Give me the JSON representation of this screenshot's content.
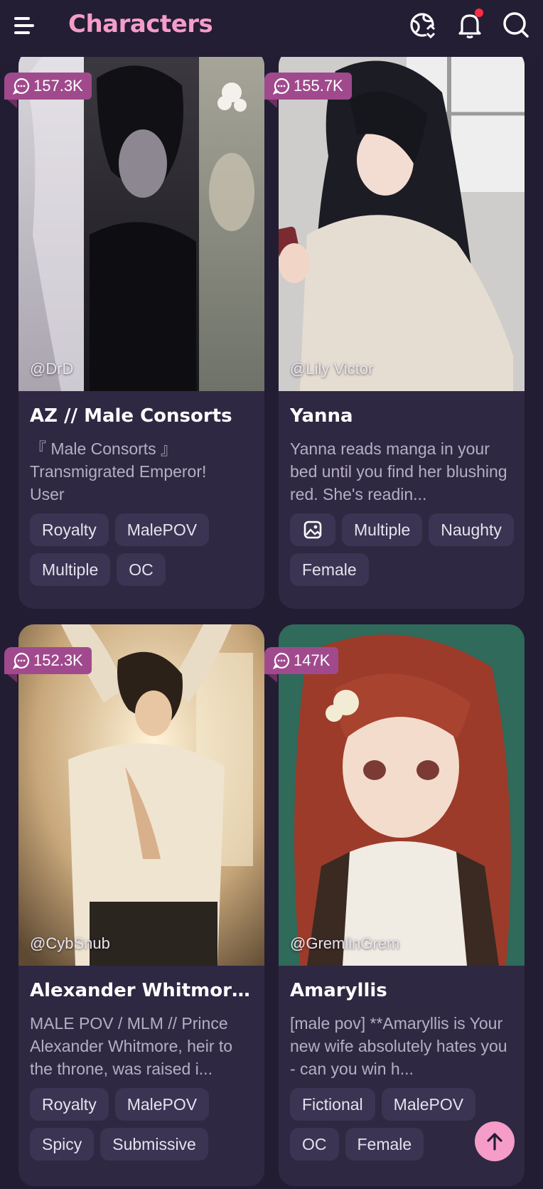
{
  "header": {
    "title": "Characters",
    "icons": [
      "menu-icon",
      "globe-language-icon",
      "bell-icon",
      "search-icon"
    ],
    "accent": "#f59cc8",
    "notification_dot_color": "#ff2d3f"
  },
  "cards": [
    {
      "chat_count": "157.3K",
      "author": "@DrD",
      "name": "AZ // Male Consorts",
      "description": "『 Male Consorts 』\nTransmigrated Emperor!\nUser",
      "tags": [
        "Royalty",
        "MalePOV",
        "Multiple",
        "OC"
      ]
    },
    {
      "chat_count": "155.7K",
      "author": "@Lily Victor",
      "name": "Yanna",
      "description": "Yanna reads manga in your bed until you find her blushing red. She's readin...",
      "has_image_tag": true,
      "tags": [
        "Multiple",
        "Naughty",
        "Female"
      ]
    },
    {
      "chat_count": "152.3K",
      "author": "@CybSnub",
      "name": "Alexander Whitmore ||...",
      "description": "MALE POV / MLM // Prince Alexander Whitmore, heir to the throne, was raised i...",
      "tags": [
        "Royalty",
        "MalePOV",
        "Spicy",
        "Submissive"
      ]
    },
    {
      "chat_count": "147K",
      "author": "@GremlinGrem",
      "name": "Amaryllis",
      "description": "[male pov] **Amaryllis is Your new wife absolutely hates you - can you win h...",
      "tags": [
        "Fictional",
        "MalePOV",
        "OC",
        "Female"
      ]
    }
  ],
  "scroll_top_icon": "arrow-up-icon",
  "colors": {
    "background": "#221d33",
    "card": "#2e2842",
    "tag": "#3b3452",
    "badge": "#a04a8d"
  }
}
